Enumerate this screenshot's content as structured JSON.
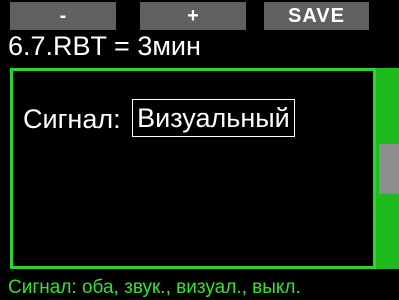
{
  "softkeys": {
    "left_label": "-",
    "middle_label": "+",
    "right_label": "SAVE"
  },
  "header": {
    "title": "6.7.RBT = 3мин"
  },
  "setting": {
    "label": "Сигнал:",
    "value": "Визуальный"
  },
  "scrollbar": {
    "position_fraction": 0.5,
    "visible_fraction": 0.25
  },
  "footer": {
    "hint": "Сигнал: оба, звук., визуал., выкл."
  },
  "colors": {
    "accent": "#2fd12f",
    "scrollbar": "#1dbb1d",
    "hint_text": "#33e233",
    "softkey_bg": "#606060",
    "background": "#000000"
  }
}
